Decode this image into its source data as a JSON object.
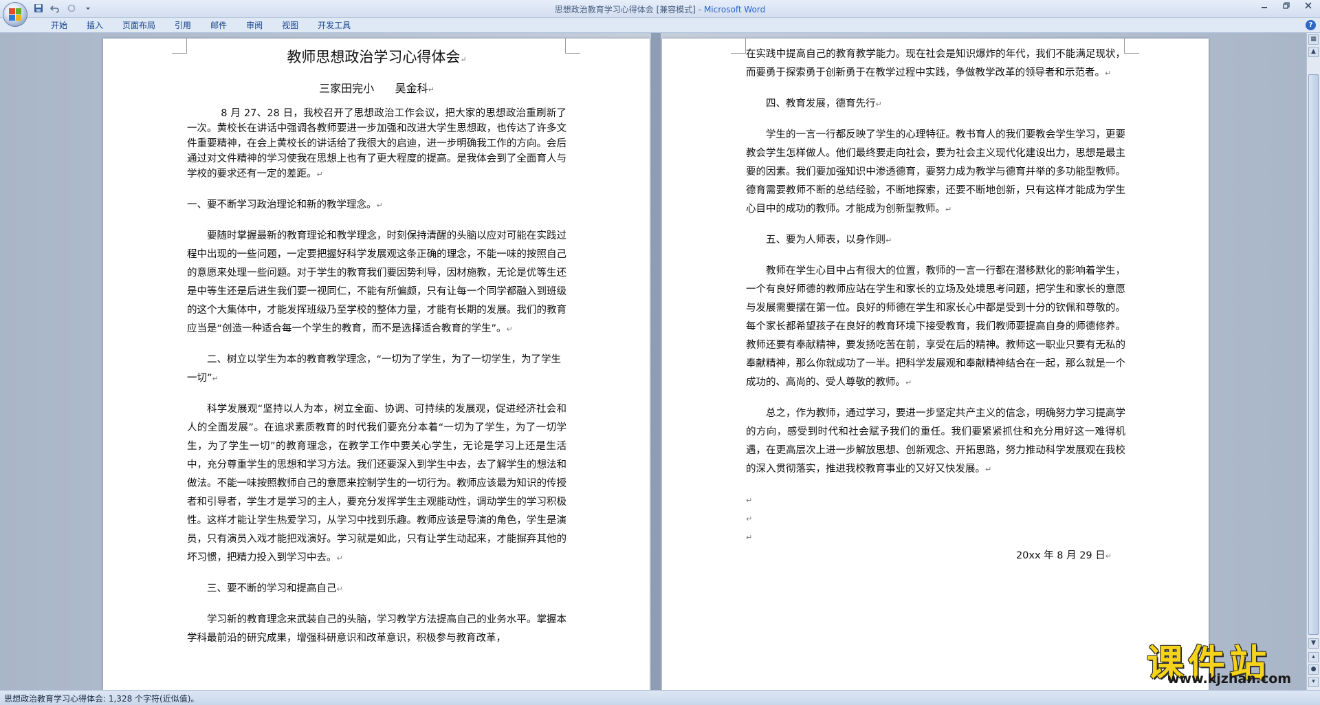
{
  "window": {
    "doc_name": "思想政治教育学习心得体会 [兼容模式]",
    "separator": " - ",
    "app_name": "Microsoft Word"
  },
  "ribbon": {
    "tabs": [
      "开始",
      "插入",
      "页面布局",
      "引用",
      "邮件",
      "审阅",
      "视图",
      "开发工具"
    ]
  },
  "icons": {
    "office_button": "office-logo-icon",
    "save": "save-icon",
    "undo": "undo-icon",
    "redo": "redo-icon",
    "customize": "dropdown-icon",
    "help": "help-icon"
  },
  "colors": {
    "ribbon_text": "#15428b",
    "app_name": "#2a64c5",
    "watermark": "#f5d31a"
  },
  "left_page": {
    "title": "教师思想政治学习心得体会",
    "author": "三家田完小      吴金科",
    "intro": "8 月 27、28 日，我校召开了思想政治工作会议，把大家的思想政治重刷新了一次。黄校长在讲话中强调各教师要进一步加强和改进大学生思想政，也传达了许多文件重要精神，在会上黄校长的讲话给了我很大的启迪，进一步明确我工作的方向。会后通过对文件精神的学习使我在思想上也有了更大程度的提高。是我体会到了全面育人与学校的要求还有一定的差距。",
    "h1": "一、要不断学习政治理论和新的教学理念。",
    "p1": "要随时掌握最新的教育理论和教学理念，时刻保持清醒的头脑以应对可能在实践过程中出现的一些问题，一定要把握好科学发展观这条正确的理念，不能一味的按照自己的意愿来处理一些问题。对于学生的教育我们要因势利导，因材施教，无论是优等生还是中等生还是后进生我们要一视同仁，不能有所偏颇，只有让每一个同学都融入到班级的这个大集体中，才能发挥班级乃至学校的整体力量，才能有长期的发展。我们的教育应当是“创造一种适合每一个学生的教育，而不是选择适合教育的学生”。",
    "h2": "二、树立以学生为本的教育教学理念，“一切为了学生，为了一切学生，为了学生一切”",
    "p2": "科学发展观“坚持以人为本，树立全面、协调、可持续的发展观，促进经济社会和人的全面发展”。在追求素质教育的时代我们要充分本着“一切为了学生，为了一切学生，为了学生一切”的教育理念，在教学工作中要关心学生，无论是学习上还是生活中，充分尊重学生的思想和学习方法。我们还要深入到学生中去，去了解学生的想法和做法。不能一味按照教师自己的意愿来控制学生的一切行为。教师应该最为知识的传授者和引导者，学生才是学习的主人，要充分发挥学生主观能动性，调动学生的学习积极性。这样才能让学生热爱学习，从学习中找到乐趣。教师应该是导演的角色，学生是演员，只有演员入戏才能把戏演好。学习就是如此，只有让学生动起来，才能摒弃其他的坏习惯，把精力投入到学习中去。",
    "h3": "三、要不断的学习和提高自己",
    "p3": "学习新的教育理念来武装自己的头脑，学习教学方法提高自己的业务水平。掌握本学科最前沿的研究成果，增强科研意识和改革意识，积极参与教育改革，"
  },
  "right_page": {
    "p0": "在实践中提高自己的教育教学能力。现在社会是知识爆炸的年代，我们不能满足现状，而要勇于探索勇于创新勇于在教学过程中实践，争做教学改革的领导者和示范者。",
    "h4": "四、教育发展，德育先行",
    "p4": "学生的一言一行都反映了学生的心理特征。教书育人的我们要教会学生学习，更要教会学生怎样做人。他们最终要走向社会，要为社会主义现代化建设出力，思想是最主要的因素。我们要加强知识中渗透德育，要努力成为教学与德育并举的多功能型教师。德育需要教师不断的总结经验，不断地探索，还要不断地创新，只有这样才能成为学生心目中的成功的教师。才能成为创新型教师。",
    "h5": "五、要为人师表，以身作则",
    "p5": "教师在学生心目中占有很大的位置，教师的一言一行都在潜移默化的影响着学生，一个有良好师德的教师应站在学生和家长的立场及处境思考问题，把学生和家长的意愿与发展需要摆在第一位。良好的师德在学生和家长心中都是受到十分的钦佩和尊敬的。每个家长都希望孩子在良好的教育环境下接受教育，我们教师要提高自身的师德修养。教师还要有奉献精神，要发扬吃苦在前，享受在后的精神。教师这一职业只要有无私的奉献精神，那么你就成功了一半。把科学发展观和奉献精神结合在一起，那么就是一个成功的、高尚的、受人尊敬的教师。",
    "p6": "总之，作为教师，通过学习，要进一步坚定共产主义的信念，明确努力学习提高学的方向，感受到时代和社会赋予我们的重任。我们要紧紧抓住和充分用好这一难得机遇，在更高层次上进一步解放思想、创新观念、开拓思路，努力推动科学发展观在我校的深入贯彻落实，推进我校教育事业的又好又快发展。",
    "date": "20xx 年 8 月 29 日"
  },
  "marks": {
    "para": "↵"
  },
  "status": {
    "text": "思想政治教育学习心得体会: 1,328 个字符(近似值)。"
  },
  "watermark": {
    "brand": "课件站",
    "url": "www.kjzhan.com"
  }
}
